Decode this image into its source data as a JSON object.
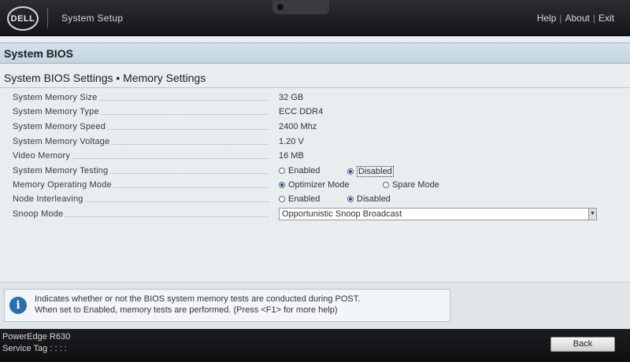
{
  "header": {
    "logo_text": "DELL",
    "app_title": "System Setup",
    "links": [
      "Help",
      "About",
      "Exit"
    ]
  },
  "section_title": "System BIOS",
  "page_title": "System BIOS Settings • Memory Settings",
  "settings": {
    "memory_size": {
      "label": "System Memory Size",
      "value": "32 GB"
    },
    "memory_type": {
      "label": "System Memory Type",
      "value": "ECC DDR4"
    },
    "memory_speed": {
      "label": "System Memory Speed",
      "value": "2400 Mhz"
    },
    "memory_voltage": {
      "label": "System Memory Voltage",
      "value": "1.20 V"
    },
    "video_memory": {
      "label": "Video Memory",
      "value": "16 MB"
    },
    "memory_testing": {
      "label": "System Memory Testing",
      "options": [
        "Enabled",
        "Disabled"
      ],
      "selected": "Disabled"
    },
    "operating_mode": {
      "label": "Memory Operating Mode",
      "options": [
        "Optimizer Mode",
        "Spare Mode"
      ],
      "selected": "Optimizer Mode"
    },
    "node_interleaving": {
      "label": "Node Interleaving",
      "options": [
        "Enabled",
        "Disabled"
      ],
      "selected": "Disabled"
    },
    "snoop_mode": {
      "label": "Snoop Mode",
      "value": "Opportunistic Snoop Broadcast"
    }
  },
  "help": {
    "line1": "Indicates whether or not the BIOS system memory tests are conducted during POST.",
    "line2": "When set to Enabled, memory tests are performed. (Press <F1> for more help)"
  },
  "footer": {
    "model": "PowerEdge R630",
    "service_tag": "Service Tag : : : :",
    "back_label": "Back"
  },
  "colors": {
    "accent_blue": "#2a6eb0",
    "header_bg": "#141518",
    "content_bg": "#e8edf0"
  }
}
